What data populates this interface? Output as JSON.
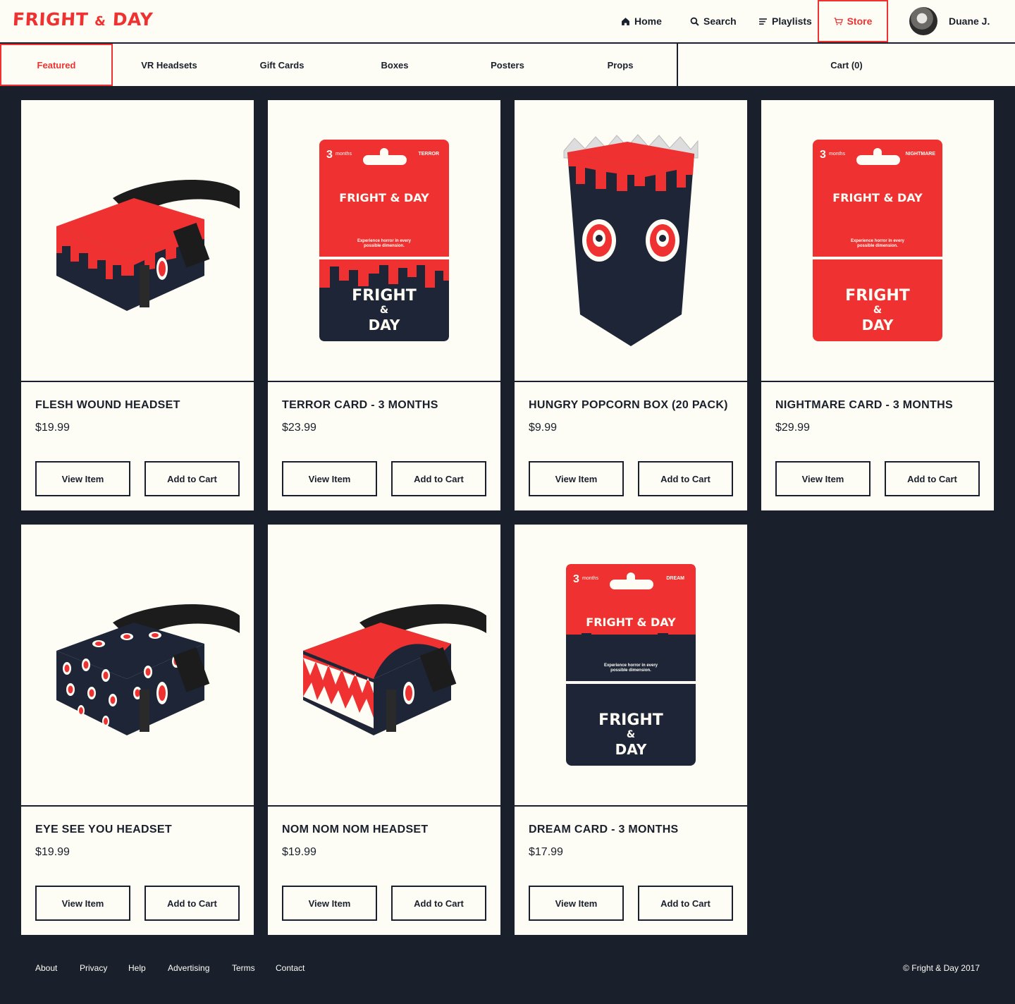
{
  "brand": {
    "logo_text_1": "FRIGHT",
    "logo_amp": "&",
    "logo_text_2": "DAY",
    "accent": "#ef3131",
    "dark": "#1a1f2c",
    "cream": "#fdfdf5"
  },
  "nav": {
    "home": "Home",
    "search": "Search",
    "playlists": "Playlists",
    "store": "Store",
    "user": "Duane J."
  },
  "categories": [
    "Featured",
    "VR Headsets",
    "Gift Cards",
    "Boxes",
    "Posters",
    "Props"
  ],
  "active_category": "Featured",
  "cart_label": "Cart (0)",
  "buttons": {
    "view": "View Item",
    "add": "Add to Cart"
  },
  "products": [
    {
      "name": "FLESH WOUND HEADSET",
      "price": "$19.99",
      "image": "vr-headset-drips"
    },
    {
      "name": "TERROR CARD - 3 MONTHS",
      "price": "$23.99",
      "image": "gift-card-terror"
    },
    {
      "name": "HUNGRY POPCORN BOX (20 PACK)",
      "price": "$9.99",
      "image": "popcorn-box"
    },
    {
      "name": "NIGHTMARE CARD - 3 MONTHS",
      "price": "$29.99",
      "image": "gift-card-nightmare"
    },
    {
      "name": "EYE SEE YOU HEADSET",
      "price": "$19.99",
      "image": "vr-headset-eyes"
    },
    {
      "name": "NOM NOM NOM HEADSET",
      "price": "$19.99",
      "image": "vr-headset-teeth"
    },
    {
      "name": "DREAM CARD - 3 MONTHS",
      "price": "$17.99",
      "image": "gift-card-dream"
    }
  ],
  "gift_cards": {
    "terror": {
      "months_num": "3",
      "months_word": "months",
      "tier": "TERROR",
      "brand": "FRIGHT & DAY",
      "tagline_1": "Experience horror in every",
      "tagline_2": "possible dimension.",
      "logo_1": "FRIGHT",
      "logo_2": "&",
      "logo_3": "DAY"
    },
    "nightmare": {
      "months_num": "3",
      "months_word": "months",
      "tier": "NIGHTMARE",
      "brand": "FRIGHT & DAY",
      "tagline_1": "Experience horror in every",
      "tagline_2": "possible dimension.",
      "logo_1": "FRIGHT",
      "logo_2": "&",
      "logo_3": "DAY"
    },
    "dream": {
      "months_num": "3",
      "months_word": "months",
      "tier": "DREAM",
      "brand": "FRIGHT & DAY",
      "tagline_1": "Experience horror in every",
      "tagline_2": "possible dimension.",
      "logo_1": "FRIGHT",
      "logo_2": "&",
      "logo_3": "DAY"
    }
  },
  "footer": {
    "links": [
      "About",
      "Privacy",
      "Help",
      "Advertising",
      "Terms",
      "Contact"
    ],
    "copyright": "© Fright & Day 2017"
  }
}
